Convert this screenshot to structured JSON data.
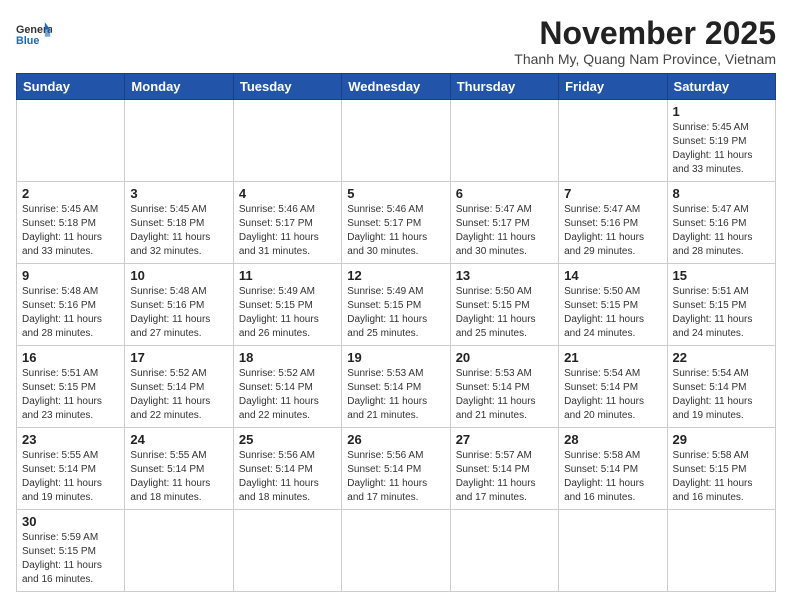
{
  "header": {
    "logo_general": "General",
    "logo_blue": "Blue",
    "month_title": "November 2025",
    "subtitle": "Thanh My, Quang Nam Province, Vietnam"
  },
  "weekdays": [
    "Sunday",
    "Monday",
    "Tuesday",
    "Wednesday",
    "Thursday",
    "Friday",
    "Saturday"
  ],
  "weeks": [
    [
      {
        "num": "",
        "info": ""
      },
      {
        "num": "",
        "info": ""
      },
      {
        "num": "",
        "info": ""
      },
      {
        "num": "",
        "info": ""
      },
      {
        "num": "",
        "info": ""
      },
      {
        "num": "",
        "info": ""
      },
      {
        "num": "1",
        "info": "Sunrise: 5:45 AM\nSunset: 5:19 PM\nDaylight: 11 hours\nand 33 minutes."
      }
    ],
    [
      {
        "num": "2",
        "info": "Sunrise: 5:45 AM\nSunset: 5:18 PM\nDaylight: 11 hours\nand 33 minutes."
      },
      {
        "num": "3",
        "info": "Sunrise: 5:45 AM\nSunset: 5:18 PM\nDaylight: 11 hours\nand 32 minutes."
      },
      {
        "num": "4",
        "info": "Sunrise: 5:46 AM\nSunset: 5:17 PM\nDaylight: 11 hours\nand 31 minutes."
      },
      {
        "num": "5",
        "info": "Sunrise: 5:46 AM\nSunset: 5:17 PM\nDaylight: 11 hours\nand 30 minutes."
      },
      {
        "num": "6",
        "info": "Sunrise: 5:47 AM\nSunset: 5:17 PM\nDaylight: 11 hours\nand 30 minutes."
      },
      {
        "num": "7",
        "info": "Sunrise: 5:47 AM\nSunset: 5:16 PM\nDaylight: 11 hours\nand 29 minutes."
      },
      {
        "num": "8",
        "info": "Sunrise: 5:47 AM\nSunset: 5:16 PM\nDaylight: 11 hours\nand 28 minutes."
      }
    ],
    [
      {
        "num": "9",
        "info": "Sunrise: 5:48 AM\nSunset: 5:16 PM\nDaylight: 11 hours\nand 28 minutes."
      },
      {
        "num": "10",
        "info": "Sunrise: 5:48 AM\nSunset: 5:16 PM\nDaylight: 11 hours\nand 27 minutes."
      },
      {
        "num": "11",
        "info": "Sunrise: 5:49 AM\nSunset: 5:15 PM\nDaylight: 11 hours\nand 26 minutes."
      },
      {
        "num": "12",
        "info": "Sunrise: 5:49 AM\nSunset: 5:15 PM\nDaylight: 11 hours\nand 25 minutes."
      },
      {
        "num": "13",
        "info": "Sunrise: 5:50 AM\nSunset: 5:15 PM\nDaylight: 11 hours\nand 25 minutes."
      },
      {
        "num": "14",
        "info": "Sunrise: 5:50 AM\nSunset: 5:15 PM\nDaylight: 11 hours\nand 24 minutes."
      },
      {
        "num": "15",
        "info": "Sunrise: 5:51 AM\nSunset: 5:15 PM\nDaylight: 11 hours\nand 24 minutes."
      }
    ],
    [
      {
        "num": "16",
        "info": "Sunrise: 5:51 AM\nSunset: 5:15 PM\nDaylight: 11 hours\nand 23 minutes."
      },
      {
        "num": "17",
        "info": "Sunrise: 5:52 AM\nSunset: 5:14 PM\nDaylight: 11 hours\nand 22 minutes."
      },
      {
        "num": "18",
        "info": "Sunrise: 5:52 AM\nSunset: 5:14 PM\nDaylight: 11 hours\nand 22 minutes."
      },
      {
        "num": "19",
        "info": "Sunrise: 5:53 AM\nSunset: 5:14 PM\nDaylight: 11 hours\nand 21 minutes."
      },
      {
        "num": "20",
        "info": "Sunrise: 5:53 AM\nSunset: 5:14 PM\nDaylight: 11 hours\nand 21 minutes."
      },
      {
        "num": "21",
        "info": "Sunrise: 5:54 AM\nSunset: 5:14 PM\nDaylight: 11 hours\nand 20 minutes."
      },
      {
        "num": "22",
        "info": "Sunrise: 5:54 AM\nSunset: 5:14 PM\nDaylight: 11 hours\nand 19 minutes."
      }
    ],
    [
      {
        "num": "23",
        "info": "Sunrise: 5:55 AM\nSunset: 5:14 PM\nDaylight: 11 hours\nand 19 minutes."
      },
      {
        "num": "24",
        "info": "Sunrise: 5:55 AM\nSunset: 5:14 PM\nDaylight: 11 hours\nand 18 minutes."
      },
      {
        "num": "25",
        "info": "Sunrise: 5:56 AM\nSunset: 5:14 PM\nDaylight: 11 hours\nand 18 minutes."
      },
      {
        "num": "26",
        "info": "Sunrise: 5:56 AM\nSunset: 5:14 PM\nDaylight: 11 hours\nand 17 minutes."
      },
      {
        "num": "27",
        "info": "Sunrise: 5:57 AM\nSunset: 5:14 PM\nDaylight: 11 hours\nand 17 minutes."
      },
      {
        "num": "28",
        "info": "Sunrise: 5:58 AM\nSunset: 5:14 PM\nDaylight: 11 hours\nand 16 minutes."
      },
      {
        "num": "29",
        "info": "Sunrise: 5:58 AM\nSunset: 5:15 PM\nDaylight: 11 hours\nand 16 minutes."
      }
    ],
    [
      {
        "num": "30",
        "info": "Sunrise: 5:59 AM\nSunset: 5:15 PM\nDaylight: 11 hours\nand 16 minutes."
      },
      {
        "num": "",
        "info": ""
      },
      {
        "num": "",
        "info": ""
      },
      {
        "num": "",
        "info": ""
      },
      {
        "num": "",
        "info": ""
      },
      {
        "num": "",
        "info": ""
      },
      {
        "num": "",
        "info": ""
      }
    ]
  ]
}
